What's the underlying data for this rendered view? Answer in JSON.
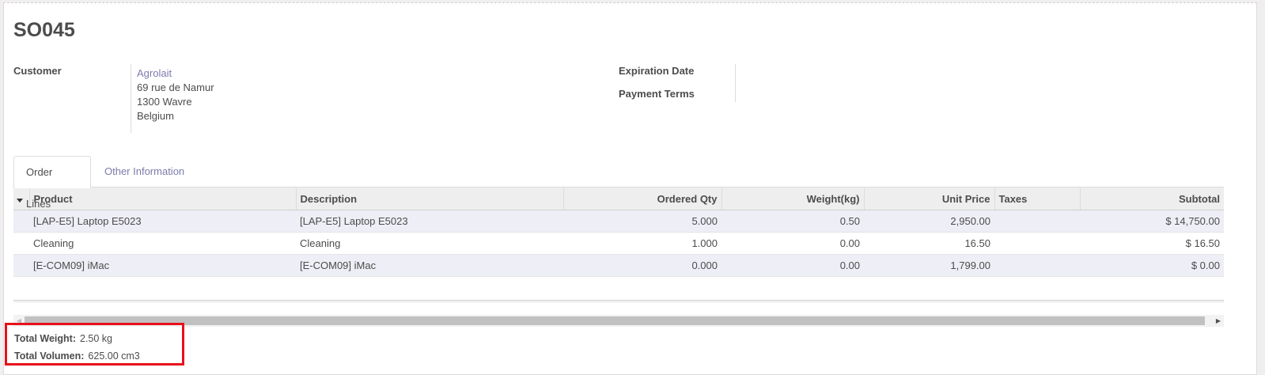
{
  "record": {
    "title": "SO045"
  },
  "fields": {
    "customer_label": "Customer",
    "customer_name": "Agrolait",
    "address_line1": "69 rue de Namur",
    "address_line2": "1300 Wavre",
    "address_line3": "Belgium",
    "expiration_label": "Expiration Date",
    "payment_terms_label": "Payment Terms"
  },
  "tabs": [
    {
      "label": "Order Lines",
      "active": true
    },
    {
      "label": "Other Information",
      "active": false
    }
  ],
  "table": {
    "columns": [
      "Product",
      "Description",
      "Ordered Qty",
      "Weight(kg)",
      "Unit Price",
      "Taxes",
      "Subtotal"
    ],
    "rows": [
      {
        "product": "[LAP-E5] Laptop E5023",
        "description": "[LAP-E5] Laptop E5023",
        "qty": "5.000",
        "weight": "0.50",
        "unit_price": "2,950.00",
        "taxes": "",
        "subtotal": "$ 14,750.00"
      },
      {
        "product": "Cleaning",
        "description": "Cleaning",
        "qty": "1.000",
        "weight": "0.00",
        "unit_price": "16.50",
        "taxes": "",
        "subtotal": "$ 16.50"
      },
      {
        "product": "[E-COM09] iMac",
        "description": "[E-COM09] iMac",
        "qty": "0.000",
        "weight": "0.00",
        "unit_price": "1,799.00",
        "taxes": "",
        "subtotal": "$ 0.00"
      }
    ]
  },
  "totals": {
    "weight_label": "Total Weight:",
    "weight_value": "2.50 kg",
    "volume_label": "Total Volumen:",
    "volume_value": "625.00 cm3"
  },
  "colors": {
    "link": "#7c7bad",
    "highlight_border": "#e8101a",
    "row_stripe": "#eeeef6"
  }
}
